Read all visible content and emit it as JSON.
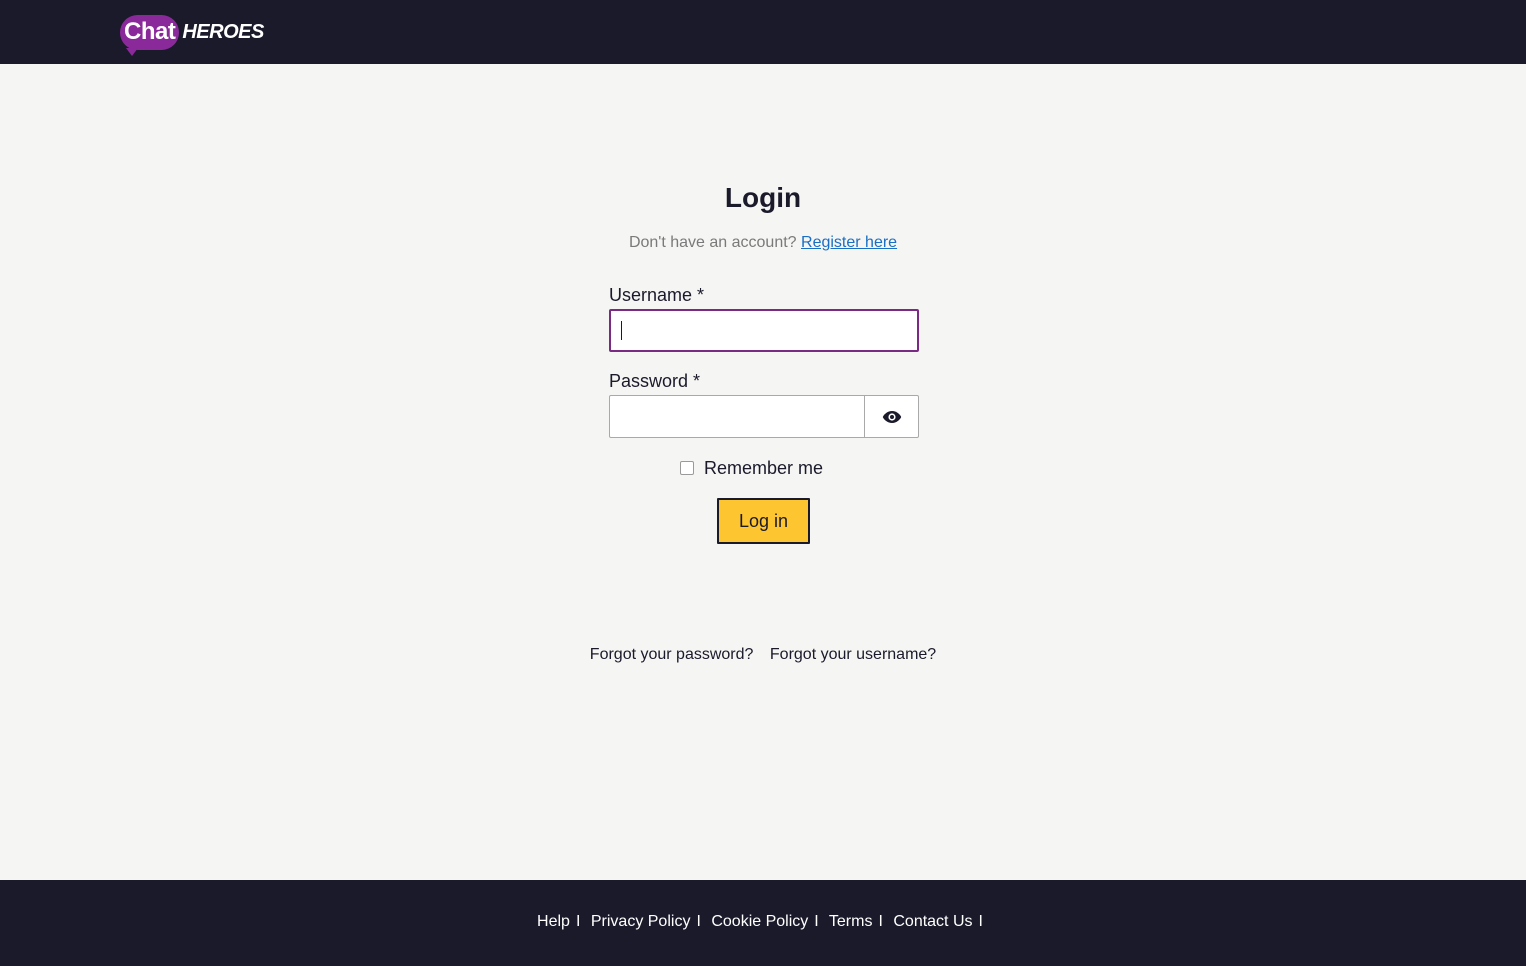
{
  "header": {
    "logo_chat": "Chat",
    "logo_heroes": "HEROES"
  },
  "login": {
    "title": "Login",
    "no_account_text": "Don't have an account?",
    "register_link": "Register here",
    "username_label": "Username *",
    "username_value": "",
    "password_label": "Password *",
    "password_value": "",
    "remember_label": "Remember me",
    "remember_checked": false,
    "submit_label": "Log in",
    "forgot_password": "Forgot your password?",
    "forgot_username": "Forgot your username?"
  },
  "footer": {
    "links": [
      {
        "label": "Help"
      },
      {
        "label": "Privacy Policy"
      },
      {
        "label": "Cookie Policy"
      },
      {
        "label": "Terms"
      },
      {
        "label": "Contact Us"
      }
    ],
    "separator": "I"
  },
  "icons": {
    "password_toggle": "eye-icon",
    "logo": "chat-heroes-logo"
  },
  "colors": {
    "header_bg": "#1b1a2b",
    "page_bg": "#f5f5f3",
    "brand_purple": "#8a2a9a",
    "focus_border": "#7a2a82",
    "button_yellow": "#fdc52f",
    "link_blue": "#1a6fc4"
  }
}
